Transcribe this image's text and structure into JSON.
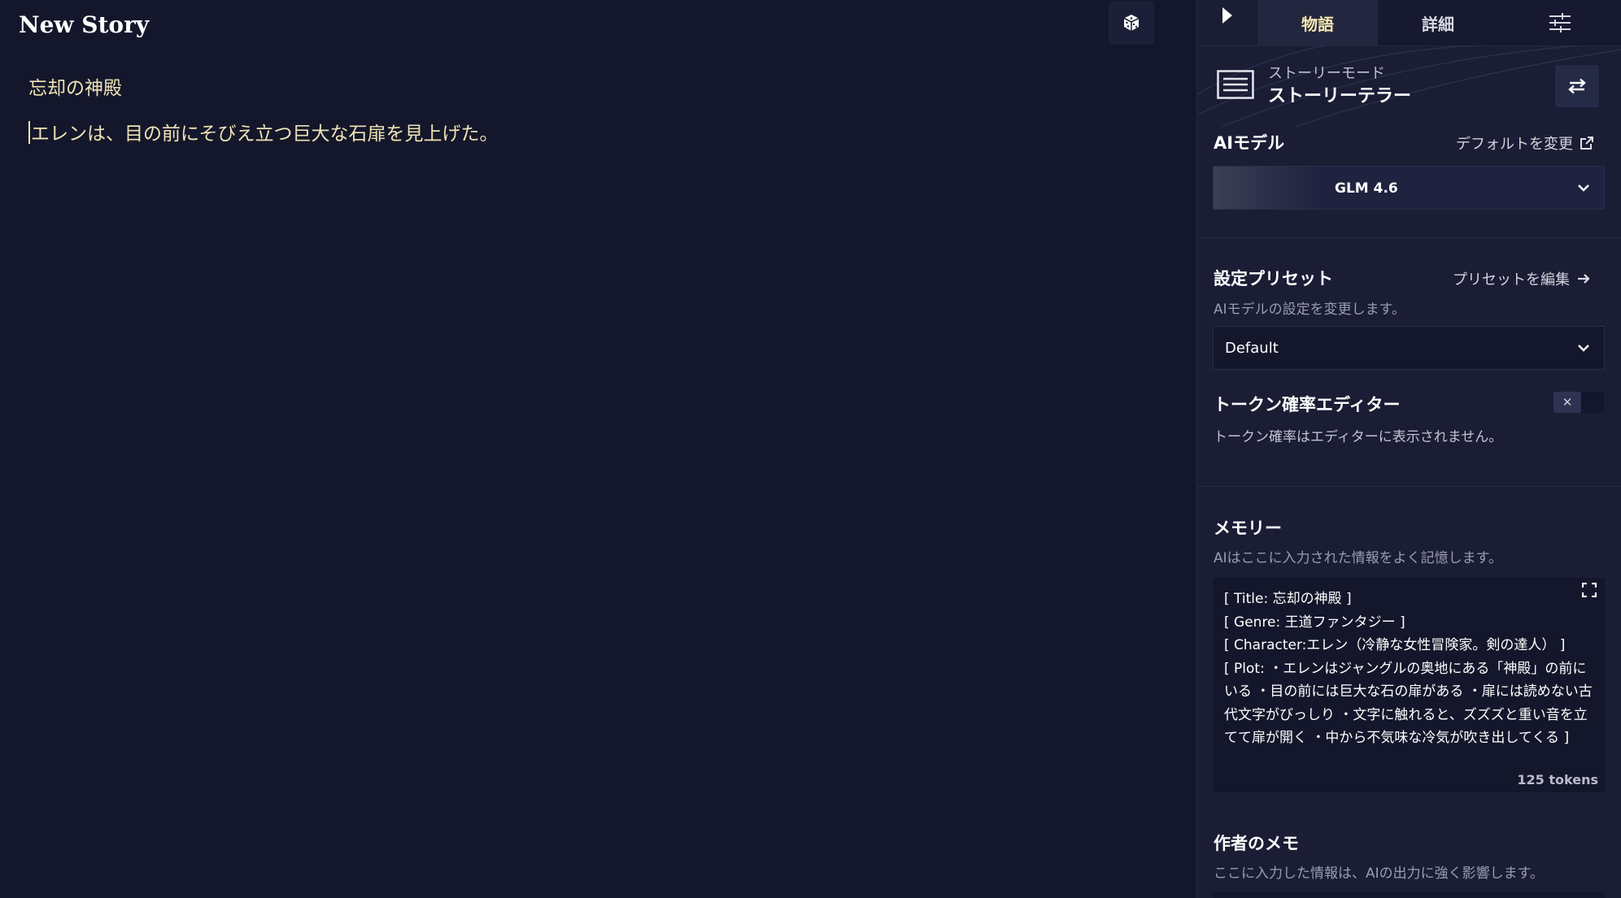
{
  "editor": {
    "title": "New Story",
    "heading": "忘却の神殿",
    "body": "エレンは、目の前にそびえ立つ巨大な石扉を見上げた。",
    "dice_icon": "dice-icon"
  },
  "sidebar": {
    "tabs": [
      {
        "label": "物語",
        "active": true
      },
      {
        "label": "詳細",
        "active": false
      }
    ],
    "tab_icons": [
      "play-icon",
      "sliders-icon"
    ],
    "mode": {
      "small": "ストーリーモード",
      "name": "ストーリーテラー"
    },
    "ai_model": {
      "title": "AIモデル",
      "link": "デフォルトを変更",
      "selected": "GLM 4.6"
    },
    "preset": {
      "title": "設定プリセット",
      "link": "プリセットを編集",
      "desc": "AIモデルの設定を変更します。",
      "selected": "Default"
    },
    "token_editor": {
      "title": "トークン確率エディター",
      "desc": "トークン確率はエディターに表示されません。",
      "toggle_glyph": "✕",
      "enabled": false
    },
    "memory": {
      "title": "メモリー",
      "desc": "AIはここに入力された情報をよく記憶します。",
      "content": "[ Title: 忘却の神殿 ]\n[ Genre: 王道ファンタジー ]\n[ Character:エレン（冷静な女性冒険家。剣の達人） ]\n[ Plot: ・エレンはジャングルの奥地にある「神殿」の前にいる ・目の前には巨大な石の扉がある ・扉には読めない古代文字がびっしり ・文字に触れると、ズズズと重い音を立てて扉が開く ・中から不気味な冷気が吹き出してくる ]",
      "tokens": "125 tokens"
    },
    "author_note": {
      "title": "作者のメモ",
      "desc": "ここに入力した情報は、AIの出力に強く影響します。"
    }
  },
  "colors": {
    "background": "#14172b",
    "sidebar": "#1a1d34",
    "story_text": "#efe3b6",
    "active_tab_text": "#f5e8b0"
  }
}
